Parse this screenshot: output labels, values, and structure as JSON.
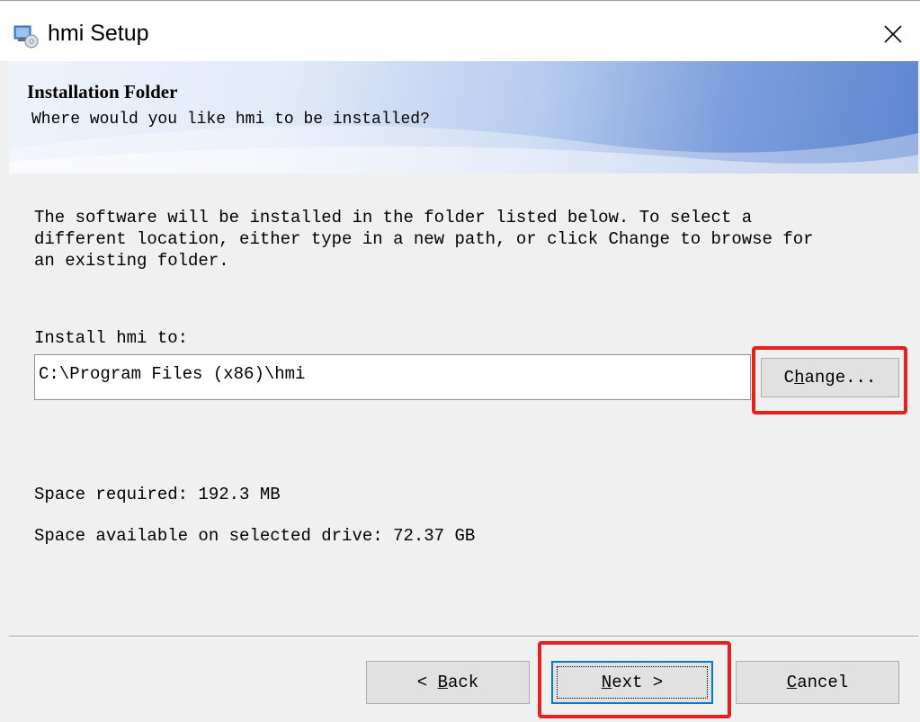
{
  "window": {
    "title": "hmi Setup",
    "close_glyph": "✕"
  },
  "banner": {
    "title": "Installation Folder",
    "subtitle": "Where would you like hmi to be installed?"
  },
  "content": {
    "description": "The software will be installed in the folder listed below. To select a\ndifferent location, either type in a new path, or click Change to browse for\nan existing folder.",
    "install_label": "Install hmi to:",
    "install_path": "C:\\Program Files (x86)\\hmi",
    "change_button": {
      "mnemonic_pre": "C",
      "mnemonic": "h",
      "post": "ange..."
    },
    "space_required": "Space required: 192.3 MB",
    "space_available": "Space available on selected drive: 72.37 GB"
  },
  "footer": {
    "back_button": {
      "pre": "< ",
      "mnemonic": "B",
      "post": "ack"
    },
    "next_button": {
      "mnemonic": "N",
      "post": "ext >"
    },
    "cancel_button": {
      "mnemonic": "C",
      "post": "ancel"
    }
  },
  "highlight_color": "#e5211d",
  "focus_color": "#0078d7",
  "icons": {
    "app": "setup-installer-icon",
    "close": "close-icon"
  }
}
